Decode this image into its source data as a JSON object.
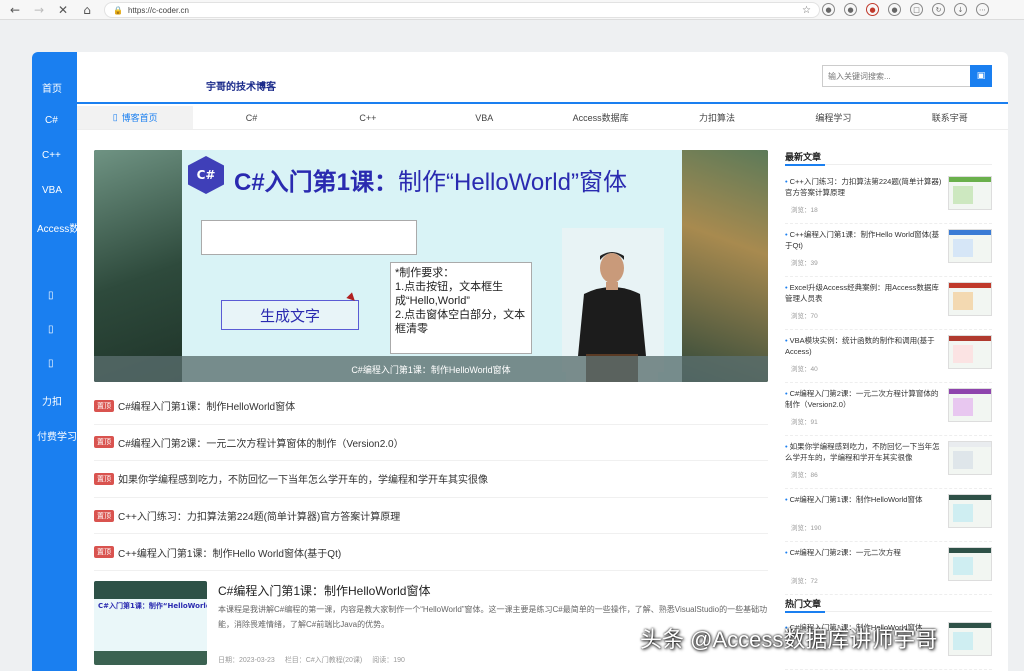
{
  "browser": {
    "url": "https://c-coder.cn"
  },
  "left_nav": [
    "首页",
    "C#",
    "C++",
    "VBA",
    "Access数据库",
    "",
    "",
    "",
    "力扣",
    "付费学习"
  ],
  "header": {
    "site_title": "宇哥的技术博客",
    "search_placeholder": "输入关键词搜索...",
    "search_icon": "search-icon"
  },
  "tabs": [
    "博客首页",
    "C#",
    "C++",
    "VBA",
    "Access数据库",
    "力扣算法",
    "编程学习",
    "联系宇哥"
  ],
  "banner": {
    "logo_text": "C#",
    "title_bold": "C#入门第1课：",
    "title_rest": "制作“HelloWorld”窗体",
    "button_text": "生成文字",
    "requirements": "*制作要求：\n1.点击按钮，文本框生成“Hello,World”\n2.点击窗体空白部分，文本框清零",
    "caption": "C#编程入门第1课：制作HelloWorld窗体"
  },
  "top_badge": "置顶",
  "top_list": [
    "C#编程入门第1课：制作HelloWorld窗体",
    "C#编程入门第2课：一元二次方程计算窗体的制作（Version2.0）",
    "如果你学编程感到吃力，不防回忆一下当年怎么学开车的，学编程和学开车其实很像",
    "C++入门练习：力扣算法第224题(简单计算器)官方答案计算原理",
    "C++编程入门第1课：制作Hello World窗体(基于Qt)"
  ],
  "article": {
    "thumb_title": "C#入门第1课：制作“HelloWorld”窗体",
    "title": "C#编程入门第1课：制作HelloWorld窗体",
    "desc": "本课程是我讲解C#编程的第一课，内容是教大家制作一个“HelloWorld”窗体。这一课主要是练习C#最简单的一些操作，了解、熟悉VisualStudio的一些基础功能，消除畏难情绪，了解C#前端比Java的优势。",
    "date": "日期：2023-03-23",
    "column": "栏目：C#入门教程(20课)",
    "views": "阅读：190"
  },
  "sidebar": {
    "latest_title": "最新文章",
    "hot_title": "热门文章",
    "latest": [
      {
        "title": "C++入门练习：力扣算法第224题(简单计算器)官方答案计算原理",
        "views": "浏览：18"
      },
      {
        "title": "C++编程入门第1课：制作Hello World窗体(基于Qt)",
        "views": "浏览：39"
      },
      {
        "title": "Excel升级Access经典案例：用Access数据库管理人员表",
        "views": "浏览：70"
      },
      {
        "title": "VBA模块实例：统计函数的制作和调用(基于Access)",
        "views": "浏览：40"
      },
      {
        "title": "C#编程入门第2课：一元二次方程计算窗体的制作（Version2.0）",
        "views": "浏览：91"
      },
      {
        "title": "如果你学编程感到吃力，不防回忆一下当年怎么学开车的，学编程和学开车其实很像",
        "views": "浏览：86"
      },
      {
        "title": "C#编程入门第1课：制作HelloWorld窗体",
        "views": "浏览：190"
      },
      {
        "title": "C#编程入门第2课：一元二次方程",
        "views": "浏览：72"
      }
    ],
    "hot_first": "C#编程入门第1课：制作HelloWorld窗体"
  },
  "watermark": "头条 @Access数据库讲师宇哥"
}
